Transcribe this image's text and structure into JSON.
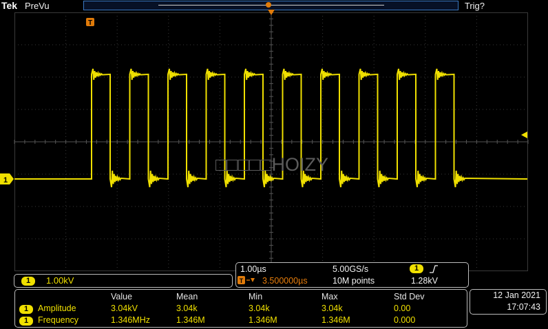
{
  "header": {
    "brand": "Tek",
    "mode": "PreVu",
    "trigger_status": "Trig?"
  },
  "channel1": {
    "badge": "1",
    "scale": "1.00kV"
  },
  "watermark": "□□□□□HOIZY",
  "timebase": {
    "time_per_div": "1.00µs",
    "sample_rate": "5.00GS/s",
    "trigger_position": "3.500000µs",
    "record_length": "10M points",
    "trigger_channel_badge": "1",
    "trigger_slope_icon": "rising-edge-icon",
    "trigger_level": "1.28kV"
  },
  "measurements": {
    "headers": [
      "Value",
      "Mean",
      "Min",
      "Max",
      "Std Dev"
    ],
    "rows": [
      {
        "badge": "1",
        "name": "Amplitude",
        "value": "3.04kV",
        "mean": "3.04k",
        "min": "3.04k",
        "max": "3.04k",
        "std": "0.00"
      },
      {
        "badge": "1",
        "name": "Frequency",
        "value": "1.346MHz",
        "mean": "1.346M",
        "min": "1.346M",
        "max": "1.346M",
        "std": "0.000"
      }
    ]
  },
  "datetime": {
    "date": "12 Jan  2021",
    "time": "17:07:43"
  },
  "colors": {
    "trace": "#f0e000",
    "trigger": "#e07b0a",
    "grid": "#3a3a3a",
    "accent_blue": "#3a79c4"
  },
  "chart_data": {
    "type": "line",
    "description_free": true,
    "waveform": {
      "pulses": 10,
      "frequency": "1.346MHz",
      "amplitude": "3.04kV"
    }
  }
}
